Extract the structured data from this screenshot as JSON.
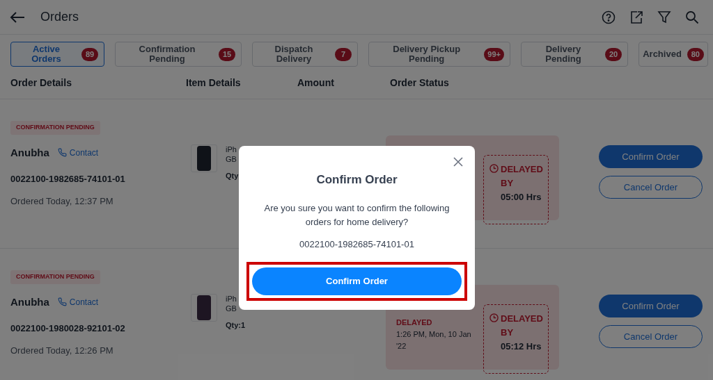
{
  "header": {
    "title": "Orders"
  },
  "tabs": [
    {
      "label": "Active Orders",
      "count": "89",
      "selected": true
    },
    {
      "label": "Confirmation Pending",
      "count": "15",
      "selected": false
    },
    {
      "label": "Dispatch Delivery",
      "count": "7",
      "selected": false
    },
    {
      "label": "Delivery Pickup Pending",
      "count": "99+",
      "selected": false
    },
    {
      "label": "Delivery Pending",
      "count": "20",
      "selected": false
    },
    {
      "label": "Archived",
      "count": "80",
      "selected": false
    }
  ],
  "columns": [
    "Order Details",
    "Item Details",
    "Amount",
    "Order Status"
  ],
  "orders": [
    {
      "tag": "CONFIRMATION PENDING",
      "name": "Anubha",
      "contact": "Contact",
      "order_id": "0022100-1982685-74101-01",
      "ordered": "Ordered Today, 12:37 PM",
      "item": {
        "name": "iPh",
        "spec": "GB",
        "qty": "Qty"
      },
      "delay_label": "DELAYED BY",
      "delay_time": "05:00 Hrs",
      "actions": [
        "Confirm Order",
        "Cancel Order"
      ]
    },
    {
      "tag": "CONFIRMATION PENDING",
      "name": "Anubha",
      "contact": "Contact",
      "order_id": "0022100-1980028-92101-02",
      "ordered": "Ordered Today, 12:26 PM",
      "item": {
        "name": "iPh",
        "spec": "GB",
        "qty": "Qty:1"
      },
      "status": [
        "DELAYED",
        "1:26 PM, Mon, 10 Jan '22"
      ],
      "delay_label": "DELAYED BY",
      "delay_time": "05:12 Hrs",
      "actions": [
        "Confirm Order",
        "Cancel Order"
      ]
    }
  ],
  "modal": {
    "title": "Confirm Order",
    "message": "Are you sure you want to confirm the following orders for home delivery?",
    "order_id": "0022100-1982685-74101-01",
    "confirm": "Confirm Order",
    "highlighted": true
  }
}
